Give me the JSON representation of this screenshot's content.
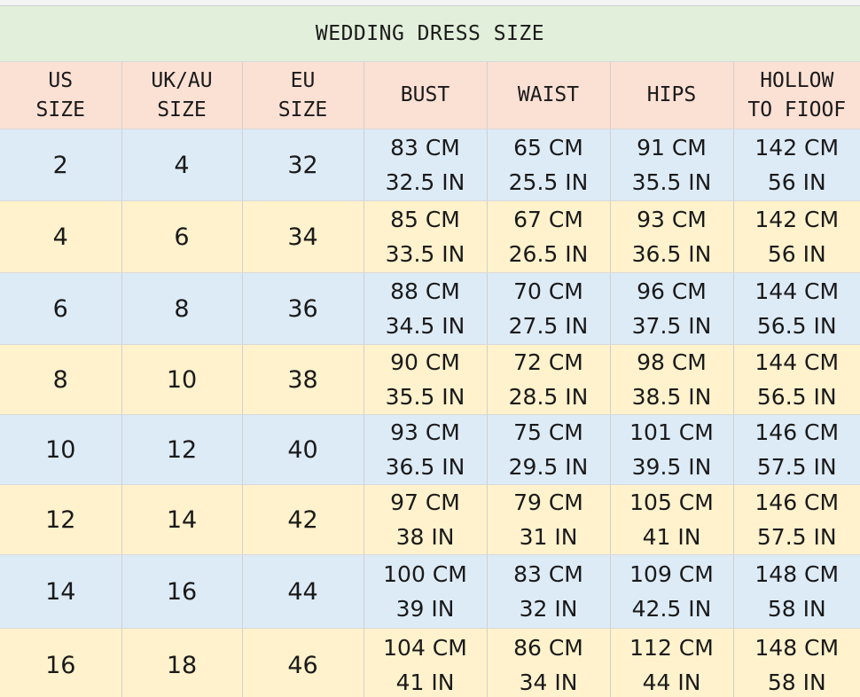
{
  "title": "WEDDING DRESS SIZE",
  "headers": [
    {
      "line1": "US",
      "line2": "SIZE"
    },
    {
      "line1": "UK/AU",
      "line2": "SIZE"
    },
    {
      "line1": "EU",
      "line2": "SIZE"
    },
    {
      "line1": "BUST",
      "line2": ""
    },
    {
      "line1": "WAIST",
      "line2": ""
    },
    {
      "line1": "HIPS",
      "line2": ""
    },
    {
      "line1": "HOLLOW",
      "line2": "TO FIOOF"
    }
  ],
  "rows": [
    {
      "us": "2",
      "uk": "4",
      "eu": "32",
      "bust_cm": "83 CM",
      "bust_in": "32.5 IN",
      "waist_cm": "65 CM",
      "waist_in": "25.5 IN",
      "hips_cm": "91 CM",
      "hips_in": "35.5 IN",
      "hollow_cm": "142 CM",
      "hollow_in": "56 IN"
    },
    {
      "us": "4",
      "uk": "6",
      "eu": "34",
      "bust_cm": "85 CM",
      "bust_in": "33.5 IN",
      "waist_cm": "67 CM",
      "waist_in": "26.5 IN",
      "hips_cm": "93 CM",
      "hips_in": "36.5 IN",
      "hollow_cm": "142 CM",
      "hollow_in": "56 IN"
    },
    {
      "us": "6",
      "uk": "8",
      "eu": "36",
      "bust_cm": "88 CM",
      "bust_in": "34.5 IN",
      "waist_cm": "70 CM",
      "waist_in": "27.5 IN",
      "hips_cm": "96 CM",
      "hips_in": "37.5 IN",
      "hollow_cm": "144 CM",
      "hollow_in": "56.5 IN"
    },
    {
      "us": "8",
      "uk": "10",
      "eu": "38",
      "bust_cm": "90 CM",
      "bust_in": "35.5 IN",
      "waist_cm": "72 CM",
      "waist_in": "28.5 IN",
      "hips_cm": "98 CM",
      "hips_in": "38.5 IN",
      "hollow_cm": "144 CM",
      "hollow_in": "56.5 IN"
    },
    {
      "us": "10",
      "uk": "12",
      "eu": "40",
      "bust_cm": "93 CM",
      "bust_in": "36.5 IN",
      "waist_cm": "75 CM",
      "waist_in": "29.5 IN",
      "hips_cm": "101 CM",
      "hips_in": "39.5 IN",
      "hollow_cm": "146 CM",
      "hollow_in": "57.5 IN"
    },
    {
      "us": "12",
      "uk": "14",
      "eu": "42",
      "bust_cm": "97 CM",
      "bust_in": "38 IN",
      "waist_cm": "79 CM",
      "waist_in": "31 IN",
      "hips_cm": "105 CM",
      "hips_in": "41 IN",
      "hollow_cm": "146 CM",
      "hollow_in": "57.5 IN"
    },
    {
      "us": "14",
      "uk": "16",
      "eu": "44",
      "bust_cm": "100 CM",
      "bust_in": "39 IN",
      "waist_cm": "83 CM",
      "waist_in": "32 IN",
      "hips_cm": "109 CM",
      "hips_in": "42.5 IN",
      "hollow_cm": "148 CM",
      "hollow_in": "58 IN"
    },
    {
      "us": "16",
      "uk": "18",
      "eu": "46",
      "bust_cm": "104 CM",
      "bust_in": "41 IN",
      "waist_cm": "86 CM",
      "waist_in": "34 IN",
      "hips_cm": "112 CM",
      "hips_in": "44 IN",
      "hollow_cm": "148 CM",
      "hollow_in": "58 IN"
    }
  ],
  "colors": {
    "title_bg": "#e2efda",
    "header_bg": "#fbe0d4",
    "row_blue": "#ddebf7",
    "row_yellow": "#fff2cc"
  }
}
